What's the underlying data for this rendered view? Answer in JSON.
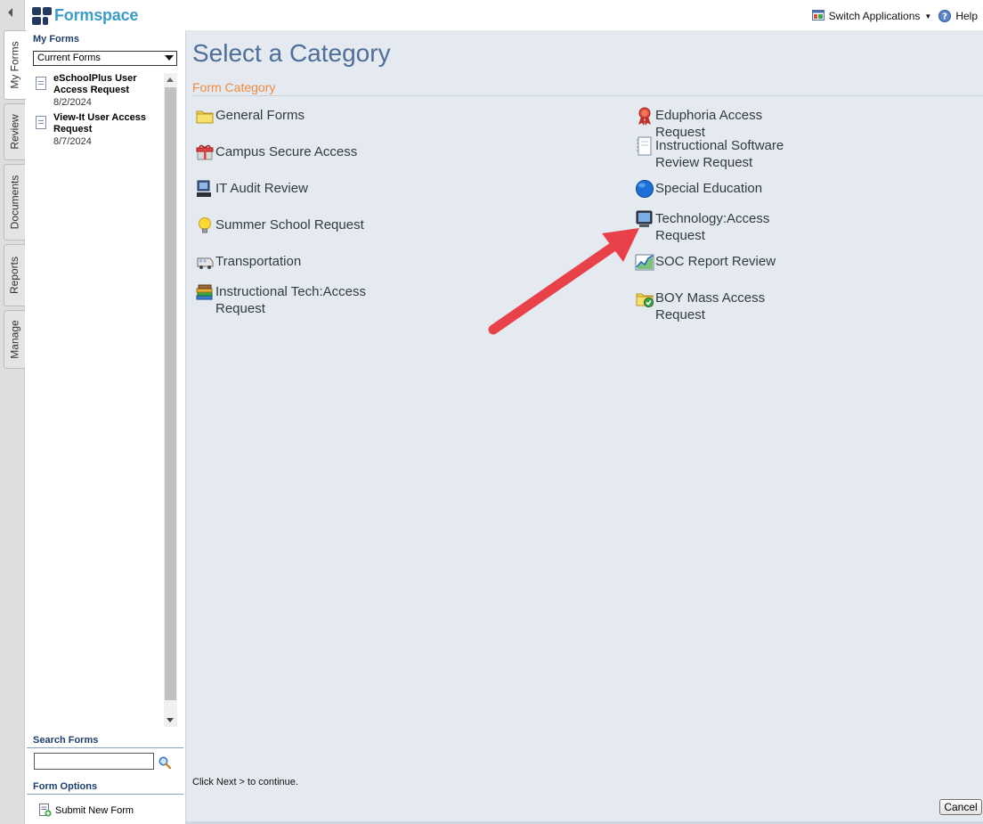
{
  "header": {
    "brand": "Formspace",
    "switch_applications": "Switch Applications",
    "help": "Help"
  },
  "tabs": [
    {
      "label": "My Forms",
      "active": true
    },
    {
      "label": "Review",
      "active": false
    },
    {
      "label": "Documents",
      "active": false
    },
    {
      "label": "Reports",
      "active": false
    },
    {
      "label": "Manage",
      "active": false
    }
  ],
  "sidebar": {
    "my_forms_title": "My Forms",
    "filter_selected": "Current Forms",
    "forms": [
      {
        "title": "eSchoolPlus User Access Request",
        "date": "8/2/2024"
      },
      {
        "title": "View-It User Access Request",
        "date": "8/7/2024"
      }
    ],
    "search_title": "Search Forms",
    "search_value": "",
    "options_title": "Form Options",
    "submit_new_form": "Submit New Form"
  },
  "main": {
    "title": "Select a Category",
    "section_header": "Form Category",
    "categories_left": [
      {
        "label": "General Forms",
        "icon": "folder-icon"
      },
      {
        "label": "Campus Secure Access",
        "icon": "gift-icon"
      },
      {
        "label": "IT Audit Review",
        "icon": "computer-icon"
      },
      {
        "label": "Summer School Request",
        "icon": "lightbulb-icon"
      },
      {
        "label": "Transportation",
        "icon": "bus-icon"
      },
      {
        "label": "Instructional Tech:Access Request",
        "icon": "books-icon"
      }
    ],
    "categories_right": [
      {
        "label": "Eduphoria Access Request",
        "icon": "ribbon-icon"
      },
      {
        "label": "Instructional Software Review Request",
        "icon": "notebook-icon"
      },
      {
        "label": "Special Education",
        "icon": "globe-icon"
      },
      {
        "label": "Technology:Access Request",
        "icon": "monitor-icon"
      },
      {
        "label": "SOC Report Review",
        "icon": "chart-icon"
      },
      {
        "label": "BOY Mass Access Request",
        "icon": "folder-check-icon"
      }
    ],
    "instruction": "Click Next > to continue.",
    "cancel": "Cancel"
  },
  "colors": {
    "title_blue": "#4f6e9a",
    "category_orange": "#f08a3c",
    "brand_blue": "#3c9cc8",
    "annotation_arrow": "#e8414a"
  }
}
